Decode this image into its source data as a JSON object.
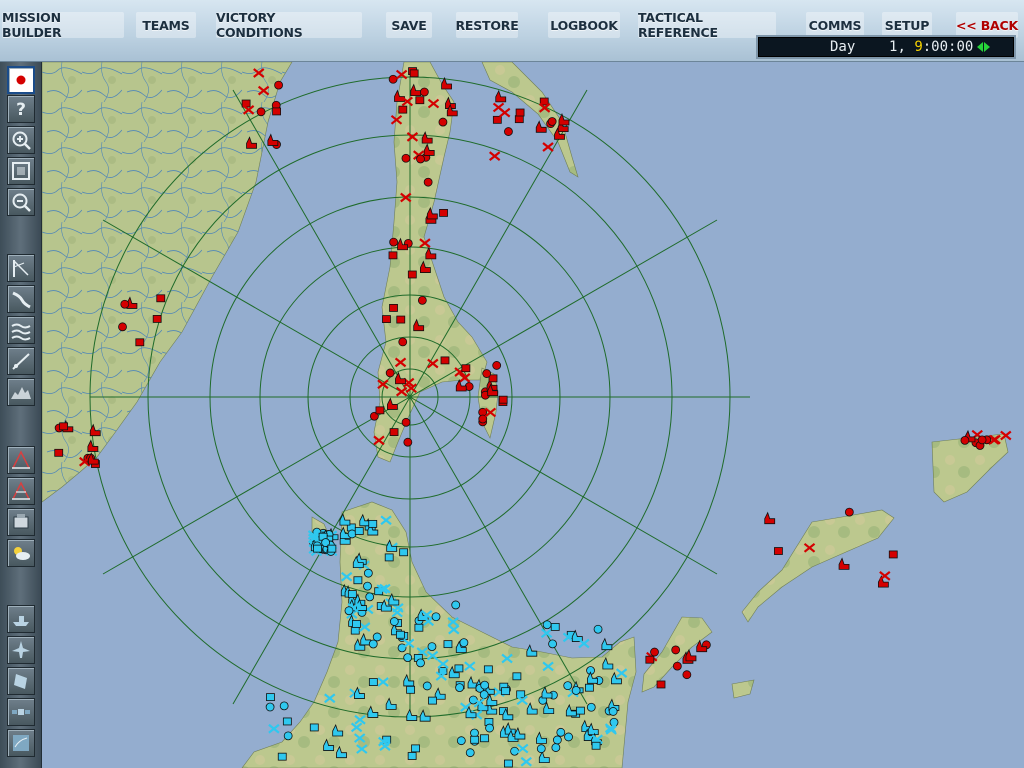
{
  "menu": {
    "mission_builder": "MISSION BUILDER",
    "teams": "TEAMS",
    "victory_conditions": "VICTORY CONDITIONS",
    "save": "SAVE",
    "restore": "RESTORE",
    "logbook": "LOGBOOK",
    "tactical_reference": "TACTICAL REFERENCE",
    "comms": "COMMS",
    "setup": "SETUP",
    "back": "<< BACK"
  },
  "clock": {
    "day_label": "Day",
    "day": "1,",
    "hour": "9",
    "rest": ":00:00"
  },
  "toolbar": {
    "icons": [
      "japan-flag-icon",
      "help-icon",
      "zoom-in-icon",
      "zoom-fit-icon",
      "zoom-out-icon",
      "measure-icon",
      "road-icon",
      "river-icon",
      "terrain-icon",
      "elevation-icon",
      "range-ring-icon",
      "range-ring-alt-icon",
      "unit-icon",
      "weather-icon",
      "ship-icon",
      "aircraft-icon",
      "sensor-icon",
      "satellite-icon",
      "map-icon"
    ]
  },
  "colors": {
    "sea": "#94adcf",
    "land": "#b7c78e",
    "red_units": "#d40000",
    "blue_units": "#2fc8ef",
    "range_rings": "#1f6b2a",
    "accent_back": "#b00000"
  }
}
